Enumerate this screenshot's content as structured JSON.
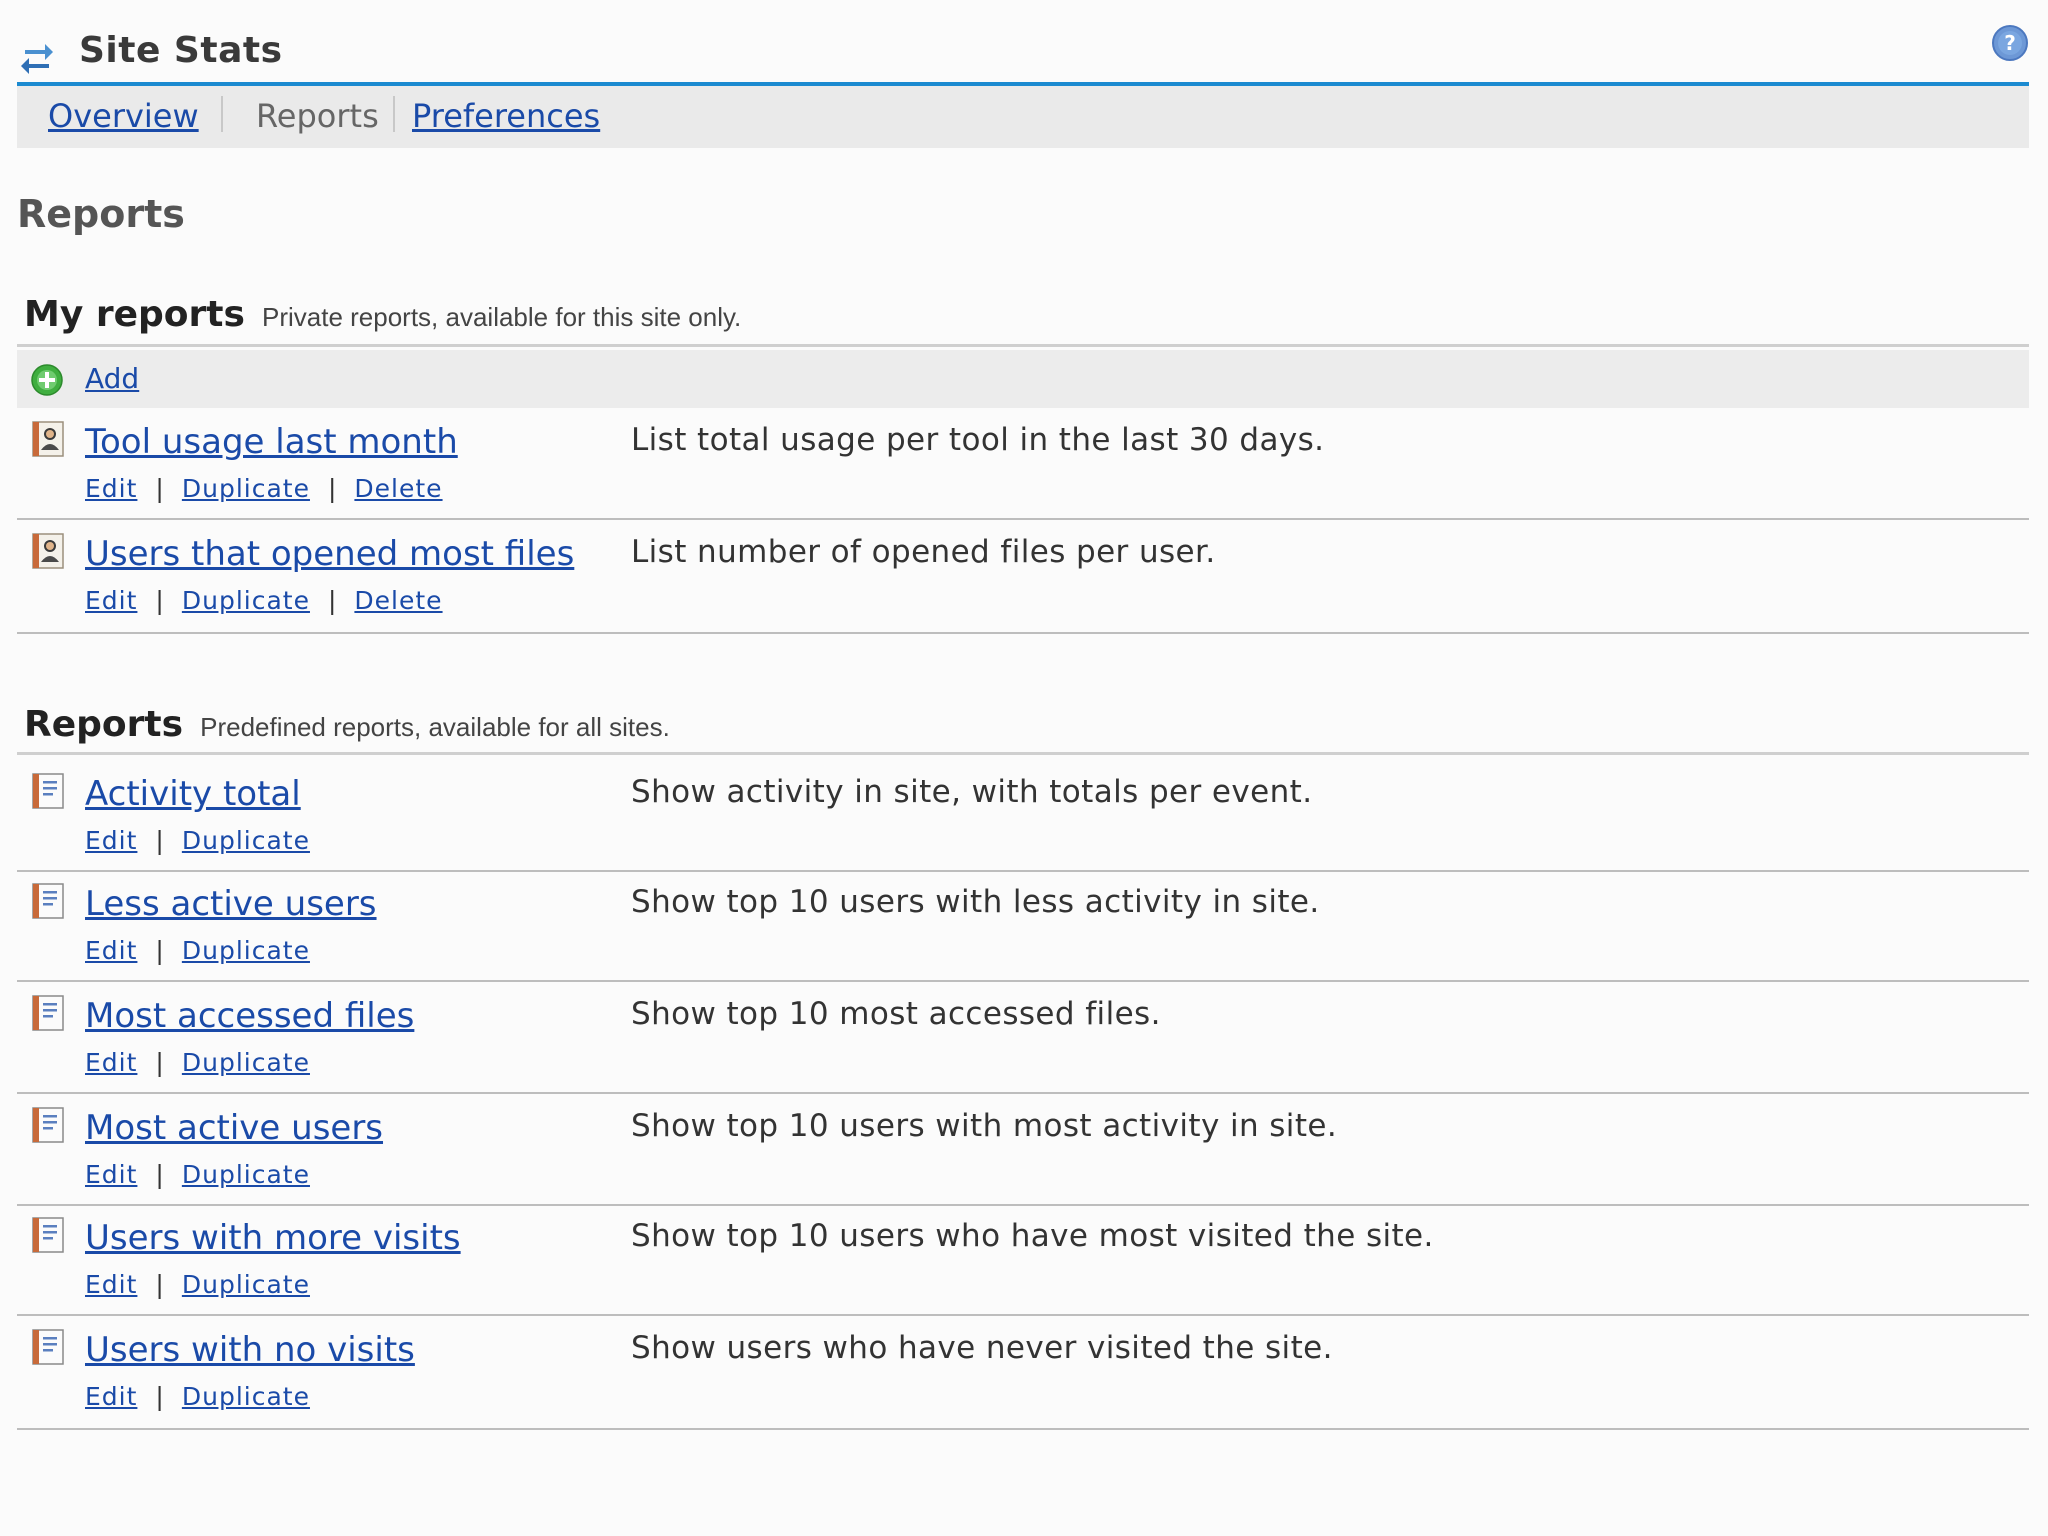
{
  "app": {
    "title": "Site Stats",
    "icon": "refresh-arrows-icon",
    "help_icon": "help-icon"
  },
  "tabs": [
    {
      "label": "Overview",
      "active": false
    },
    {
      "label": "Reports",
      "active": true
    },
    {
      "label": "Preferences",
      "active": false
    }
  ],
  "page_title": "Reports",
  "my_reports": {
    "name": "My reports",
    "description": "Private reports, available for this site only.",
    "add_label": "Add",
    "items": [
      {
        "title": "Tool usage last month",
        "description": "List total usage per tool in the last 30 days.",
        "actions": [
          "Edit",
          "Duplicate",
          "Delete"
        ]
      },
      {
        "title": "Users that opened most files",
        "description": "List number of opened files per user.",
        "actions": [
          "Edit",
          "Duplicate",
          "Delete"
        ]
      }
    ]
  },
  "predefined_reports": {
    "name": "Reports",
    "description": "Predefined reports, available for all sites.",
    "items": [
      {
        "title": "Activity total",
        "description": "Show activity in site, with totals per event.",
        "actions": [
          "Edit",
          "Duplicate"
        ]
      },
      {
        "title": "Less active users",
        "description": "Show top 10 users with less activity in site.",
        "actions": [
          "Edit",
          "Duplicate"
        ]
      },
      {
        "title": "Most accessed files",
        "description": "Show top 10 most accessed files.",
        "actions": [
          "Edit",
          "Duplicate"
        ]
      },
      {
        "title": "Most active users",
        "description": "Show top 10 users with most activity in site.",
        "actions": [
          "Edit",
          "Duplicate"
        ]
      },
      {
        "title": "Users with more visits",
        "description": "Show top 10 users who have most visited the site.",
        "actions": [
          "Edit",
          "Duplicate"
        ]
      },
      {
        "title": "Users with no visits",
        "description": "Show users who have never visited the site.",
        "actions": [
          "Edit",
          "Duplicate"
        ]
      }
    ]
  },
  "colors": {
    "accent_rule": "#1b8ad0",
    "link": "#1a4aa8",
    "tab_bar": "#eaeaea"
  }
}
